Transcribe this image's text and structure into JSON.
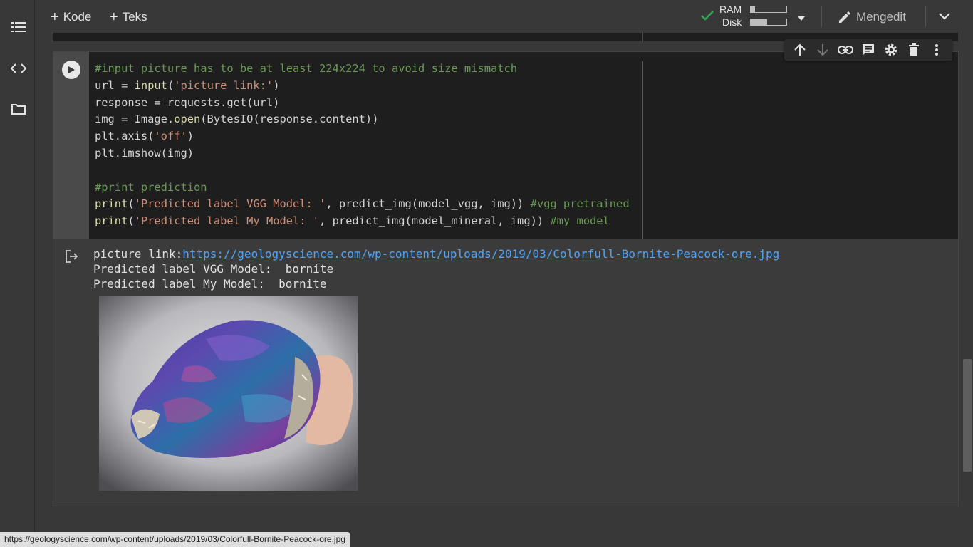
{
  "toolbar": {
    "add_code": "Kode",
    "add_text": "Teks",
    "ram_label": "RAM",
    "disk_label": "Disk",
    "ram_usage": 0.12,
    "disk_usage": 0.45,
    "mode_label": "Mengedit"
  },
  "cell": {
    "code_lines": [
      "#input picture has to be at least 224x224 to avoid size mismatch",
      "url = input('picture link:')",
      "response = requests.get(url)",
      "img = Image.open(BytesIO(response.content))",
      "plt.axis('off')",
      "plt.imshow(img)",
      "",
      "#print prediction",
      "print('Predicted label VGG Model: ', predict_img(model_vgg, img)) #vgg pretrained",
      "print('Predicted label My Model: ', predict_img(model_mineral, img)) #my model"
    ]
  },
  "output": {
    "prompt_label": "picture link:",
    "link": "https://geologyscience.com/wp-content/uploads/2019/03/Colorfull-Bornite-Peacock-ore.jpg",
    "line_vgg": "Predicted label VGG Model:  bornite",
    "line_my": "Predicted label My Model:  bornite"
  },
  "status_url": "https://geologyscience.com/wp-content/uploads/2019/03/Colorfull-Bornite-Peacock-ore.jpg",
  "icons": {
    "rail": [
      "list-icon",
      "code-icon",
      "folder-icon"
    ],
    "cell_toolbar": [
      "arrow-up-icon",
      "arrow-down-icon",
      "link-icon",
      "comment-icon",
      "gear-icon",
      "trash-icon",
      "more-vert-icon"
    ]
  },
  "colors": {
    "accent_check": "#34a853",
    "link": "#4fa3f7",
    "comment": "#6a9955",
    "string": "#ce9178",
    "function": "#dcdcaa"
  }
}
